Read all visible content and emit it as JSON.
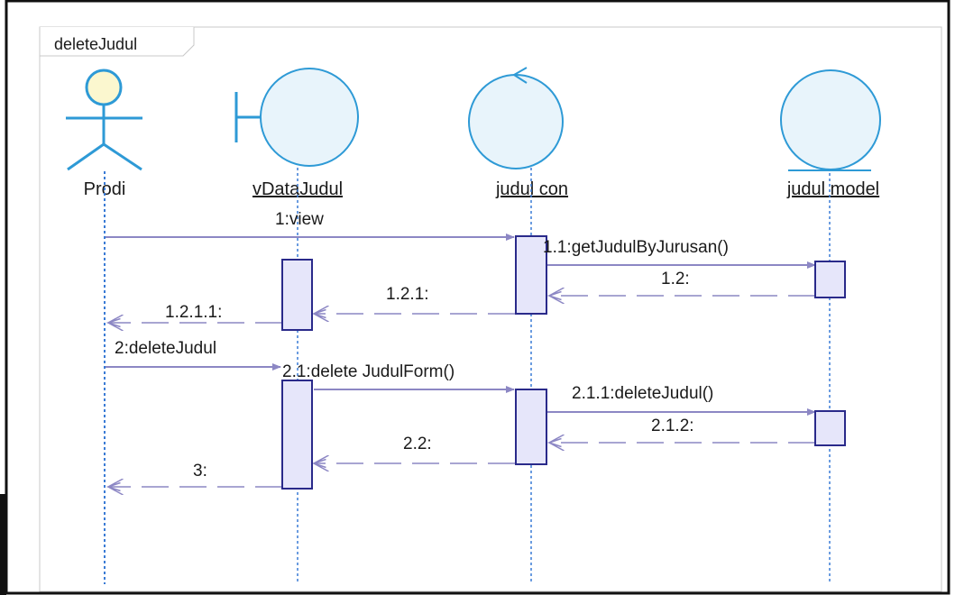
{
  "frame": {
    "title": "deleteJudul"
  },
  "lifelines": [
    {
      "id": "prodi",
      "name": "Prodi",
      "kind": "actor",
      "underlined": false
    },
    {
      "id": "vdatajudul",
      "name": "vDataJudul",
      "kind": "boundary",
      "underlined": true
    },
    {
      "id": "judulcon",
      "name": "judul con",
      "kind": "control",
      "underlined": true
    },
    {
      "id": "judulmodel",
      "name": "judul model",
      "kind": "entity",
      "underlined": true
    }
  ],
  "messages": [
    {
      "id": "m-1",
      "label": "1:view",
      "from": "prodi",
      "to": "judulcon",
      "type": "call"
    },
    {
      "id": "m-1-1",
      "label": "1.1:getJudulByJurusan()",
      "from": "judulcon",
      "to": "judulmodel",
      "type": "call"
    },
    {
      "id": "m-1-2",
      "label": "1.2:",
      "from": "judulmodel",
      "to": "judulcon",
      "type": "return"
    },
    {
      "id": "m-1-2-1",
      "label": "1.2.1:",
      "from": "judulcon",
      "to": "vdatajudul",
      "type": "return"
    },
    {
      "id": "m-1-2-1-1",
      "label": "1.2.1.1:",
      "from": "vdatajudul",
      "to": "prodi",
      "type": "return"
    },
    {
      "id": "m-2",
      "label": "2:deleteJudul",
      "from": "prodi",
      "to": "vdatajudul",
      "type": "call"
    },
    {
      "id": "m-2-1",
      "label": "2.1:delete JudulForm()",
      "from": "vdatajudul",
      "to": "judulcon",
      "type": "call"
    },
    {
      "id": "m-2-1-1",
      "label": "2.1.1:deleteJudul()",
      "from": "judulcon",
      "to": "judulmodel",
      "type": "call"
    },
    {
      "id": "m-2-1-2",
      "label": "2.1.2:",
      "from": "judulmodel",
      "to": "judulcon",
      "type": "return"
    },
    {
      "id": "m-2-2",
      "label": "2.2:",
      "from": "judulcon",
      "to": "vdatajudul",
      "type": "return"
    },
    {
      "id": "m-3",
      "label": "3:",
      "from": "vdatajudul",
      "to": "prodi",
      "type": "return"
    }
  ],
  "colors": {
    "lifeline": "#3a7bd5",
    "message_line": "#8c87c4",
    "activation_fill": "#e6e6fa",
    "activation_stroke": "#2a2a8a",
    "object_fill": "#e8f4fb",
    "object_stroke": "#2e9ad6",
    "actor_head_fill": "#fbf7cf",
    "actor_stroke": "#2e9ad6"
  }
}
